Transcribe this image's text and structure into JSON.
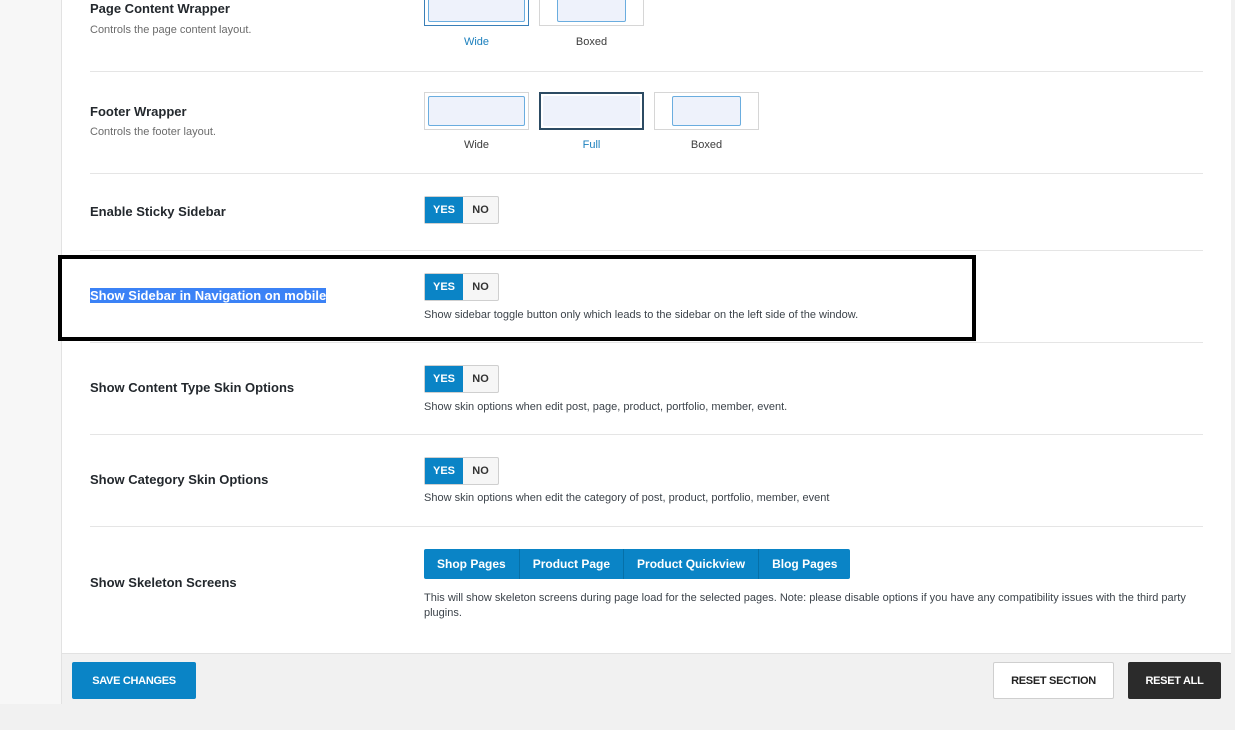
{
  "rows": {
    "page_content": {
      "title": "Page Content Wrapper",
      "subtitle": "Controls the page content layout.",
      "options": [
        "Wide",
        "Boxed"
      ],
      "selected": "Wide"
    },
    "footer": {
      "title": "Footer Wrapper",
      "subtitle": "Controls the footer layout.",
      "options": [
        "Wide",
        "Full",
        "Boxed"
      ],
      "selected": "Full"
    },
    "sticky_sidebar": {
      "title": "Enable Sticky Sidebar",
      "yes": "YES",
      "no": "NO",
      "value": "YES"
    },
    "sidebar_mobile": {
      "title": "Show Sidebar in Navigation on mobile",
      "yes": "YES",
      "no": "NO",
      "value": "YES",
      "description": "Show sidebar toggle button only which leads to the sidebar on the left side of the window."
    },
    "content_skin": {
      "title": "Show Content Type Skin Options",
      "yes": "YES",
      "no": "NO",
      "value": "YES",
      "description": "Show skin options when edit post, page, product, portfolio, member, event."
    },
    "category_skin": {
      "title": "Show Category Skin Options",
      "yes": "YES",
      "no": "NO",
      "value": "YES",
      "description": "Show skin options when edit the category of post, product, portfolio, member, event"
    },
    "skeleton": {
      "title": "Show Skeleton Screens",
      "buttons": [
        "Shop Pages",
        "Product Page",
        "Product Quickview",
        "Blog Pages"
      ],
      "description": "This will show skeleton screens during page load for the selected pages. Note: please disable options if you have any compatibility issues with the third party plugins."
    }
  },
  "footer_bar": {
    "save_label": "SAVE CHANGES",
    "reset_section_label": "RESET SECTION",
    "reset_all_label": "RESET ALL"
  },
  "colors": {
    "accent": "#0a84c6",
    "dark_button": "#2b2b2b",
    "highlight_border": "#000000",
    "text_selection": "#3b82f6"
  }
}
